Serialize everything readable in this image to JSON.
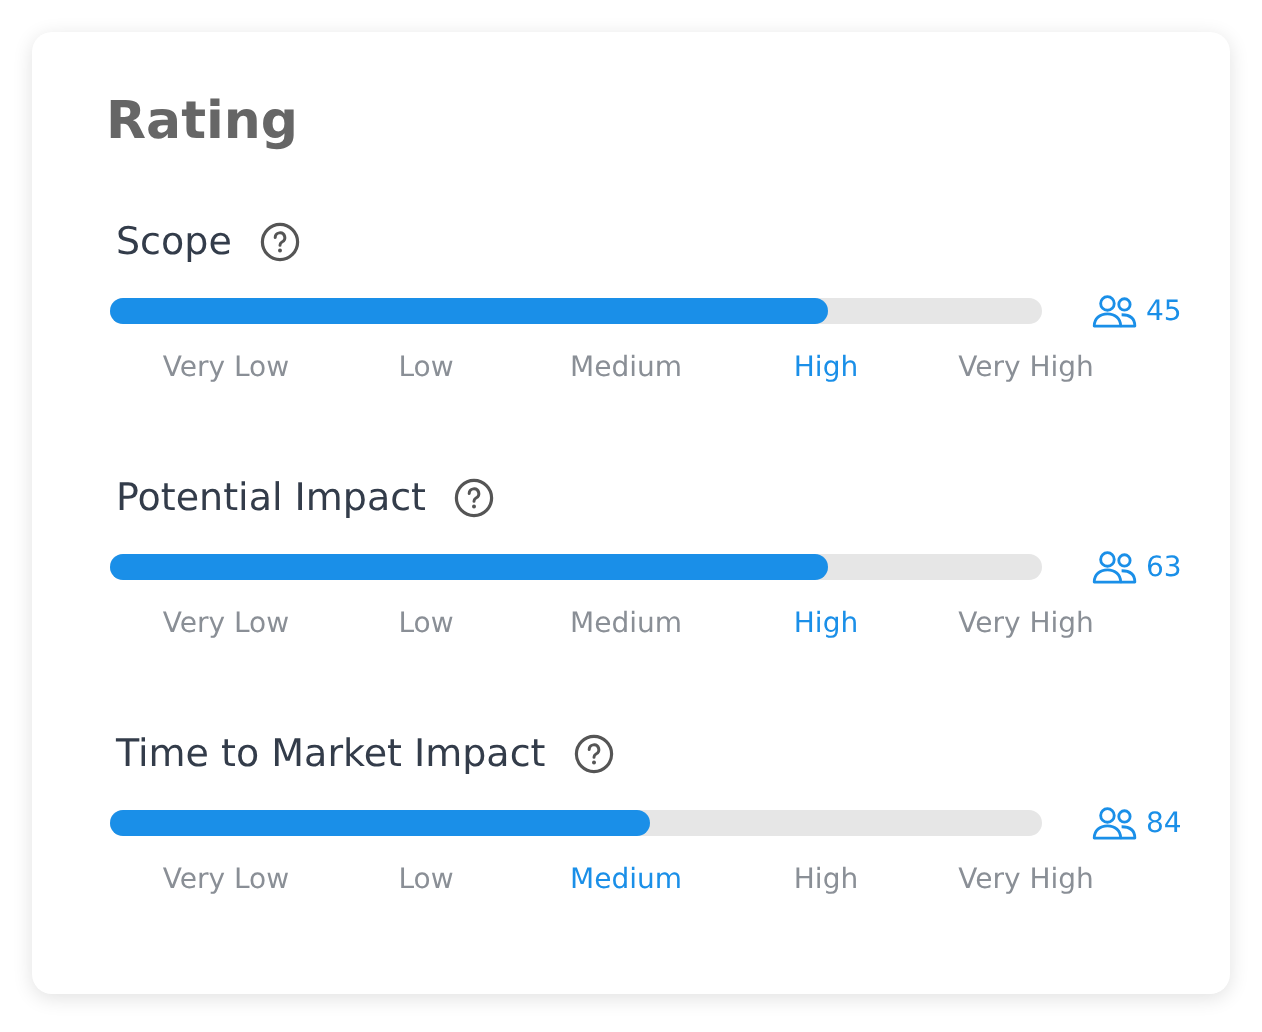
{
  "card": {
    "title": "Rating"
  },
  "ratings": [
    {
      "label": "Scope",
      "level": 0.77,
      "count": "45",
      "scale": [
        {
          "label": "Very Low",
          "selected": false
        },
        {
          "label": "Low",
          "selected": false
        },
        {
          "label": "Medium",
          "selected": false
        },
        {
          "label": "High",
          "selected": true
        },
        {
          "label": "Very High",
          "selected": false
        }
      ]
    },
    {
      "label": "Potential Impact",
      "level": 0.77,
      "count": "63",
      "scale": [
        {
          "label": "Very Low",
          "selected": false
        },
        {
          "label": "Low",
          "selected": false
        },
        {
          "label": "Medium",
          "selected": false
        },
        {
          "label": "High",
          "selected": true
        },
        {
          "label": "Very High",
          "selected": false
        }
      ]
    },
    {
      "label": "Time to Market Impact",
      "level": 0.58,
      "count": "84",
      "scale": [
        {
          "label": "Very Low",
          "selected": false
        },
        {
          "label": "Low",
          "selected": false
        },
        {
          "label": "Medium",
          "selected": true
        },
        {
          "label": "High",
          "selected": false
        },
        {
          "label": "Very High",
          "selected": false
        }
      ]
    }
  ]
}
